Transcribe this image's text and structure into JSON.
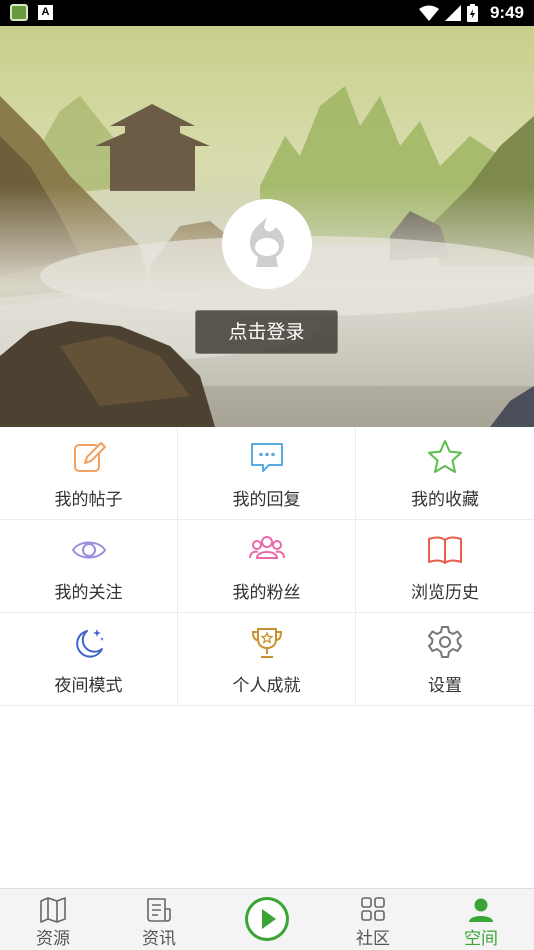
{
  "status_bar": {
    "time": "9:49",
    "left_icons": [
      "app-notification-icon",
      "a-notification-icon"
    ],
    "right_icons": [
      "wifi-icon",
      "signal-icon",
      "battery-icon"
    ]
  },
  "header": {
    "login_label": "点击登录",
    "avatar_icon": "default-avatar-icon"
  },
  "menu": {
    "items": [
      {
        "label": "我的帖子",
        "icon": "edit-icon",
        "color": "#f0a060"
      },
      {
        "label": "我的回复",
        "icon": "chat-bubble-icon",
        "color": "#5aabdf"
      },
      {
        "label": "我的收藏",
        "icon": "star-icon",
        "color": "#5cbd4f"
      },
      {
        "label": "我的关注",
        "icon": "eye-icon",
        "color": "#9b8fdc"
      },
      {
        "label": "我的粉丝",
        "icon": "group-icon",
        "color": "#e86aa8"
      },
      {
        "label": "浏览历史",
        "icon": "open-book-icon",
        "color": "#e85f4a"
      },
      {
        "label": "夜间模式",
        "icon": "moon-icon",
        "color": "#3e63c9"
      },
      {
        "label": "个人成就",
        "icon": "trophy-icon",
        "color": "#c9922e"
      },
      {
        "label": "设置",
        "icon": "gear-icon",
        "color": "#777777"
      }
    ]
  },
  "bottom_nav": {
    "items": [
      {
        "label": "资源",
        "icon": "map-icon"
      },
      {
        "label": "资讯",
        "icon": "news-icon"
      },
      {
        "label": "",
        "icon": "play-icon"
      },
      {
        "label": "社区",
        "icon": "grid-icon"
      },
      {
        "label": "空间",
        "icon": "person-icon",
        "active": true
      }
    ],
    "accent_color": "#3aa536"
  }
}
